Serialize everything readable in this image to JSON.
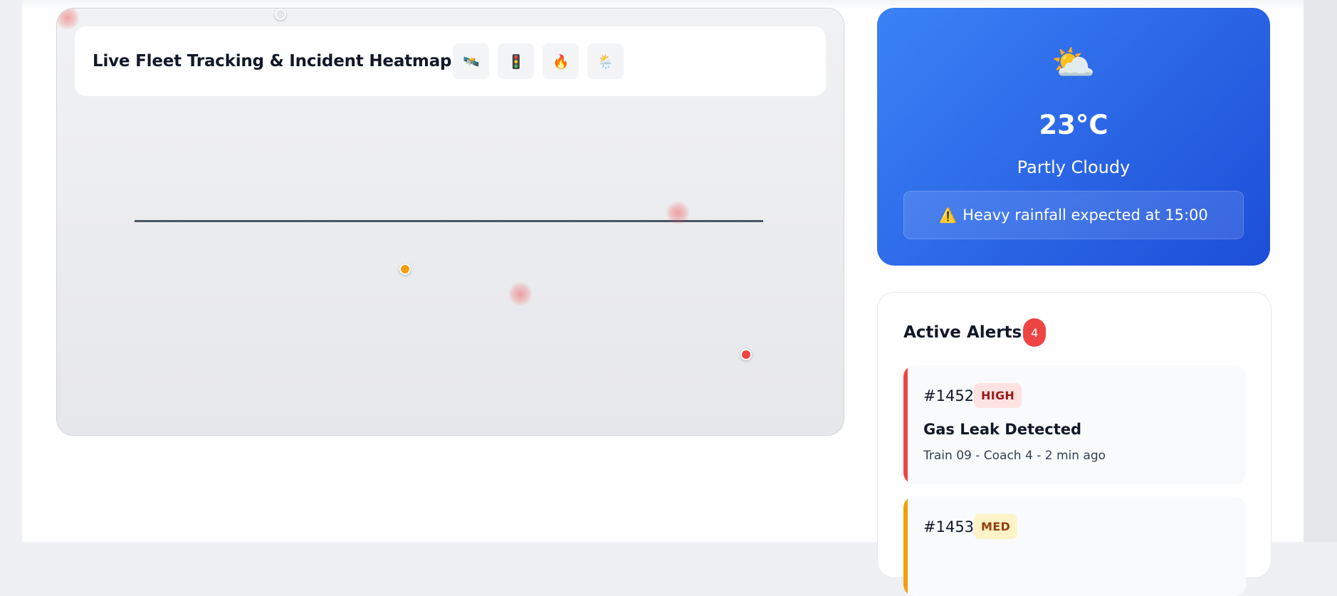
{
  "map": {
    "title": "Live Fleet Tracking & Incident Heatmap",
    "tools": [
      {
        "icon": "satellite-icon",
        "glyph": "🛰️"
      },
      {
        "icon": "traffic-light-icon",
        "glyph": "🚦"
      },
      {
        "icon": "fire-icon",
        "glyph": "🔥"
      },
      {
        "icon": "weather-icon",
        "glyph": "🌦️"
      }
    ]
  },
  "weather": {
    "icon": "⛅",
    "temperature": "23°C",
    "condition": "Partly Cloudy",
    "warning_icon": "⚠️",
    "warning": "Heavy rainfall expected at 15:00"
  },
  "alerts": {
    "title": "Active Alerts",
    "count": "4",
    "items": [
      {
        "id": "#1452",
        "severity": "HIGH",
        "title": "Gas Leak Detected",
        "meta": "Train 09 - Coach 4 - 2 min ago",
        "color": "#ef4444",
        "badge_bg": "#fee2e2",
        "badge_fg": "#991b1b"
      },
      {
        "id": "#1453",
        "severity": "MED",
        "title": "",
        "meta": "",
        "color": "#f59e0b",
        "badge_bg": "#fef3c7",
        "badge_fg": "#92400e"
      }
    ]
  },
  "colors": {
    "accent": "#3b82f6",
    "alert_high": "#ef4444",
    "alert_med": "#f59e0b",
    "vehicle_dot_orange": "#f59e0b",
    "vehicle_dot_red": "#ef4444",
    "vehicle_dot_gray": "#e5e7eb"
  }
}
